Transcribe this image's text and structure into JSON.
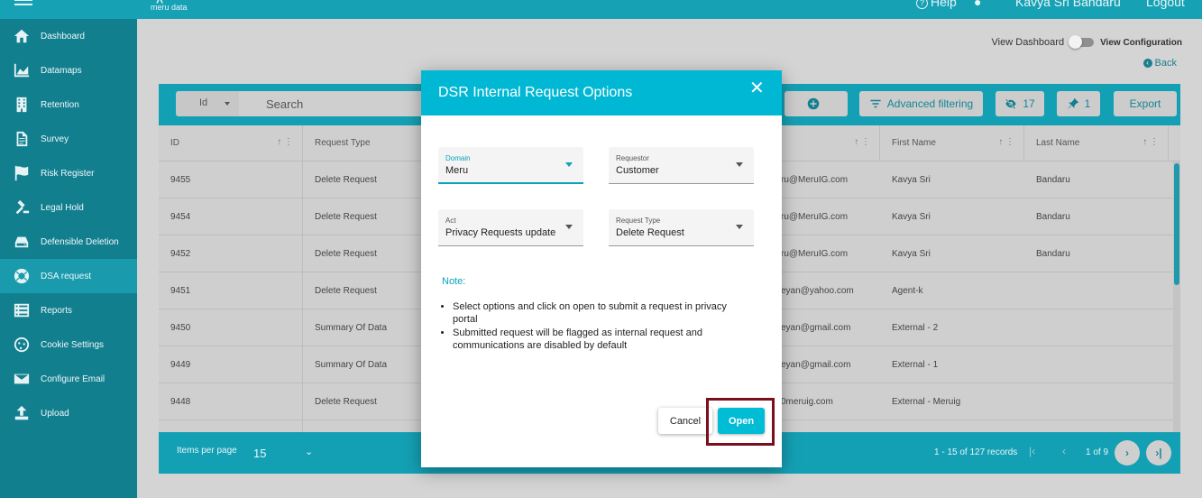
{
  "header": {
    "logo_text": "meru data",
    "help_label": "Help",
    "user_name": "Kavya Sri Bandaru",
    "logout_label": "Logout"
  },
  "sidebar": {
    "items": [
      {
        "label": "Dashboard",
        "icon": "home-icon"
      },
      {
        "label": "Datamaps",
        "icon": "area-chart-icon"
      },
      {
        "label": "Retention",
        "icon": "building-icon"
      },
      {
        "label": "Survey",
        "icon": "document-icon"
      },
      {
        "label": "Risk Register",
        "icon": "flag-icon"
      },
      {
        "label": "Legal Hold",
        "icon": "gavel-icon"
      },
      {
        "label": "Defensible Deletion",
        "icon": "drive-icon"
      },
      {
        "label": "DSA request",
        "icon": "lifebuoy-icon",
        "active": true
      },
      {
        "label": "Reports",
        "icon": "list-icon"
      },
      {
        "label": "Cookie Settings",
        "icon": "cookie-icon"
      },
      {
        "label": "Configure Email",
        "icon": "envelope-icon"
      },
      {
        "label": "Upload",
        "icon": "upload-icon"
      }
    ]
  },
  "main": {
    "view_dashboard_label": "View Dashboard",
    "view_configuration_label": "View Configuration",
    "back_label": "Back"
  },
  "toolbar": {
    "id_select": "Id",
    "search_placeholder": "Search",
    "advanced_filtering": "Advanced filtering",
    "hidden_count": "17",
    "pinned_count": "1",
    "export_label": "Export"
  },
  "table": {
    "headers": [
      "ID",
      "Request Type",
      "First Name",
      "Last Name"
    ],
    "rows": [
      {
        "id": "9455",
        "type": "Delete Request",
        "email": "ru@MeruIG.com",
        "first": "Kavya Sri",
        "last": "Bandaru"
      },
      {
        "id": "9454",
        "type": "Delete Request",
        "email": "ru@MeruIG.com",
        "first": "Kavya Sri",
        "last": "Bandaru"
      },
      {
        "id": "9452",
        "type": "Delete Request",
        "email": "ru@MeruIG.com",
        "first": "Kavya Sri",
        "last": "Bandaru"
      },
      {
        "id": "9451",
        "type": "Delete Request",
        "email": "eyan@yahoo.com",
        "first": "Agent-k",
        "last": ""
      },
      {
        "id": "9450",
        "type": "Summary Of Data",
        "email": "eyan@gmail.com",
        "first": "External - 2",
        "last": ""
      },
      {
        "id": "9449",
        "type": "Summary Of Data",
        "email": "eyan@gmail.com",
        "first": "External - 1",
        "last": ""
      },
      {
        "id": "9448",
        "type": "Delete Request",
        "email": "0meruig.com",
        "first": "External - Meruig",
        "last": ""
      }
    ]
  },
  "footer": {
    "items_per_page_label": "Items per page",
    "items_per_page_value": "15",
    "records": "1 - 15 of 127 records",
    "page_of": "1 of 9"
  },
  "modal": {
    "title": "DSR Internal Request Options",
    "fields": {
      "domain": {
        "label": "Domain",
        "value": "Meru"
      },
      "requestor": {
        "label": "Requestor",
        "value": "Customer"
      },
      "act": {
        "label": "Act",
        "value": "Privacy Requests update"
      },
      "request_type": {
        "label": "Request Type",
        "value": "Delete Request"
      }
    },
    "note_title": "Note:",
    "notes": [
      "Select options and click on open to submit a request in privacy portal",
      "Submitted request will be flagged as internal request and communications are disabled by default"
    ],
    "cancel_label": "Cancel",
    "open_label": "Open"
  },
  "colors": {
    "header_bg": "#17a1b5",
    "sidebar_bg": "#127f8f",
    "modal_header": "#00b8d4",
    "highlight": "#7a0f1f"
  }
}
